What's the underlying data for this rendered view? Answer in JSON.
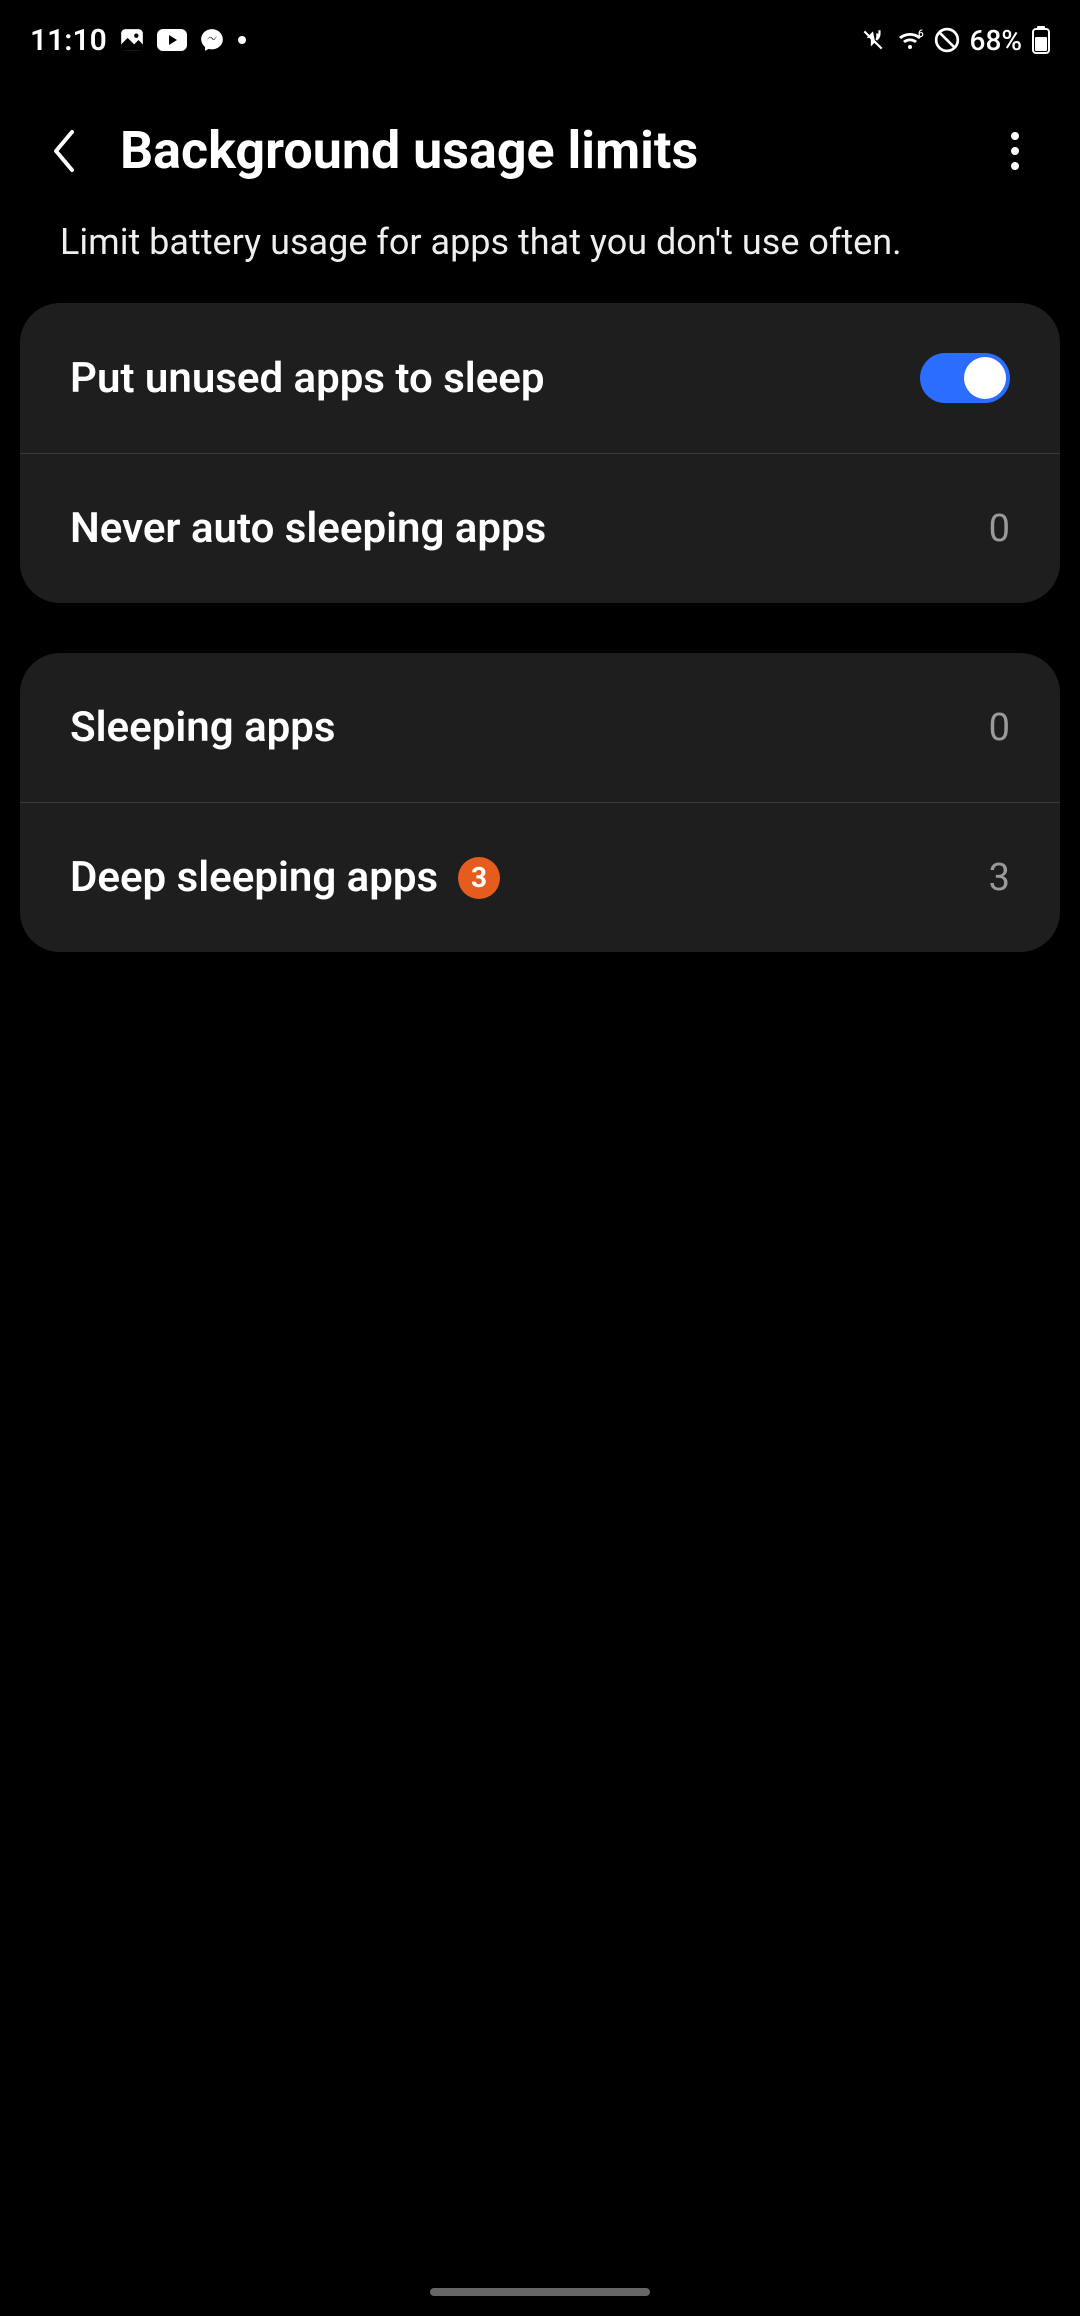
{
  "statusbar": {
    "time": "11:10",
    "battery": "68%"
  },
  "header": {
    "title": "Background usage limits"
  },
  "subtitle": "Limit battery usage for apps that you don't use often.",
  "card1": {
    "row1": {
      "label": "Put unused apps to sleep"
    },
    "row2": {
      "label": "Never auto sleeping apps",
      "value": "0"
    }
  },
  "card2": {
    "row1": {
      "label": "Sleeping apps",
      "value": "0"
    },
    "row2": {
      "label": "Deep sleeping apps",
      "badge": "3",
      "value": "3"
    }
  }
}
